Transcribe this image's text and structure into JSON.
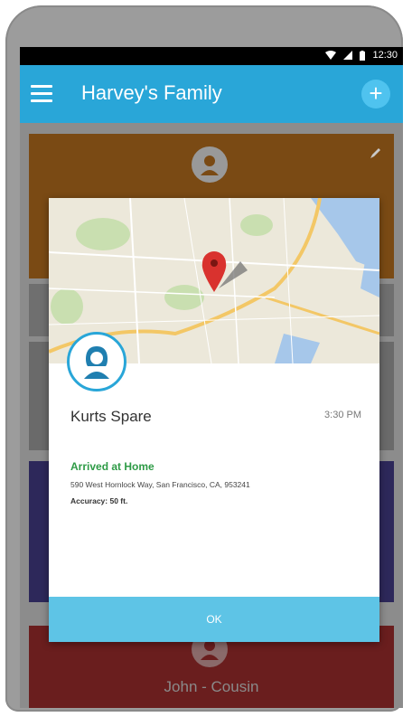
{
  "statusbar": {
    "time": "12:30"
  },
  "appbar": {
    "title": "Harvey's Family"
  },
  "background_cards": {
    "bottom_card_name": "John - Cousin"
  },
  "dialog": {
    "member_name": "Kurts Spare",
    "time": "3:30 PM",
    "status": "Arrived at Home",
    "address": "590 West Hornlock Way, San Francisco, CA, 953241",
    "accuracy": "Accuracy: 50 ft.",
    "ok_label": "OK"
  },
  "colors": {
    "accent": "#29a6d8",
    "ok_button": "#5ec4e6",
    "status_green": "#2e9b46",
    "map_pin": "#d9322e"
  },
  "icons": {
    "menu": "menu-icon",
    "add": "add-icon",
    "pin": "map-pin-icon",
    "avatar": "avatar-icon"
  }
}
